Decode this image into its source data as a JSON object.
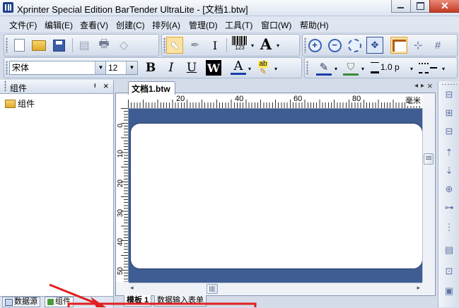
{
  "window": {
    "title": "Xprinter Special Edition BarTender UltraLite - [文档1.btw]"
  },
  "menu": [
    "文件(F)",
    "编辑(E)",
    "查看(V)",
    "创建(C)",
    "排列(A)",
    "管理(D)",
    "工具(T)",
    "窗口(W)",
    "帮助(H)"
  ],
  "toolbar2": {
    "font_name": "宋体",
    "font_size": "12",
    "bold": "B",
    "italic": "I",
    "underline": "U",
    "reverse": "W",
    "text_color_letter": "A",
    "highlight_letters": "ab",
    "line_width": "1.0 p",
    "barcode_digits": "123",
    "text_tool_letter": "A"
  },
  "left_panel": {
    "title": "组件",
    "pin": "ᵻ",
    "close": "×",
    "tree_item": "组件"
  },
  "document": {
    "tab_label": "文档1.btw",
    "ruler_unit": "毫米",
    "h_ticks": [
      "20",
      "40",
      "60",
      "80"
    ],
    "v_ticks": [
      "0",
      "10",
      "20",
      "30",
      "40",
      "50"
    ],
    "nav_left": "◂",
    "nav_right": "▸",
    "nav_close": "×"
  },
  "bottom_tabs": {
    "template": "模板 1",
    "data_entry": "数据输入表单",
    "datasource": "数据源",
    "components": "组件"
  },
  "colors": {
    "canvas_bg": "#3f5d93",
    "annotation_red": "#e02020"
  }
}
